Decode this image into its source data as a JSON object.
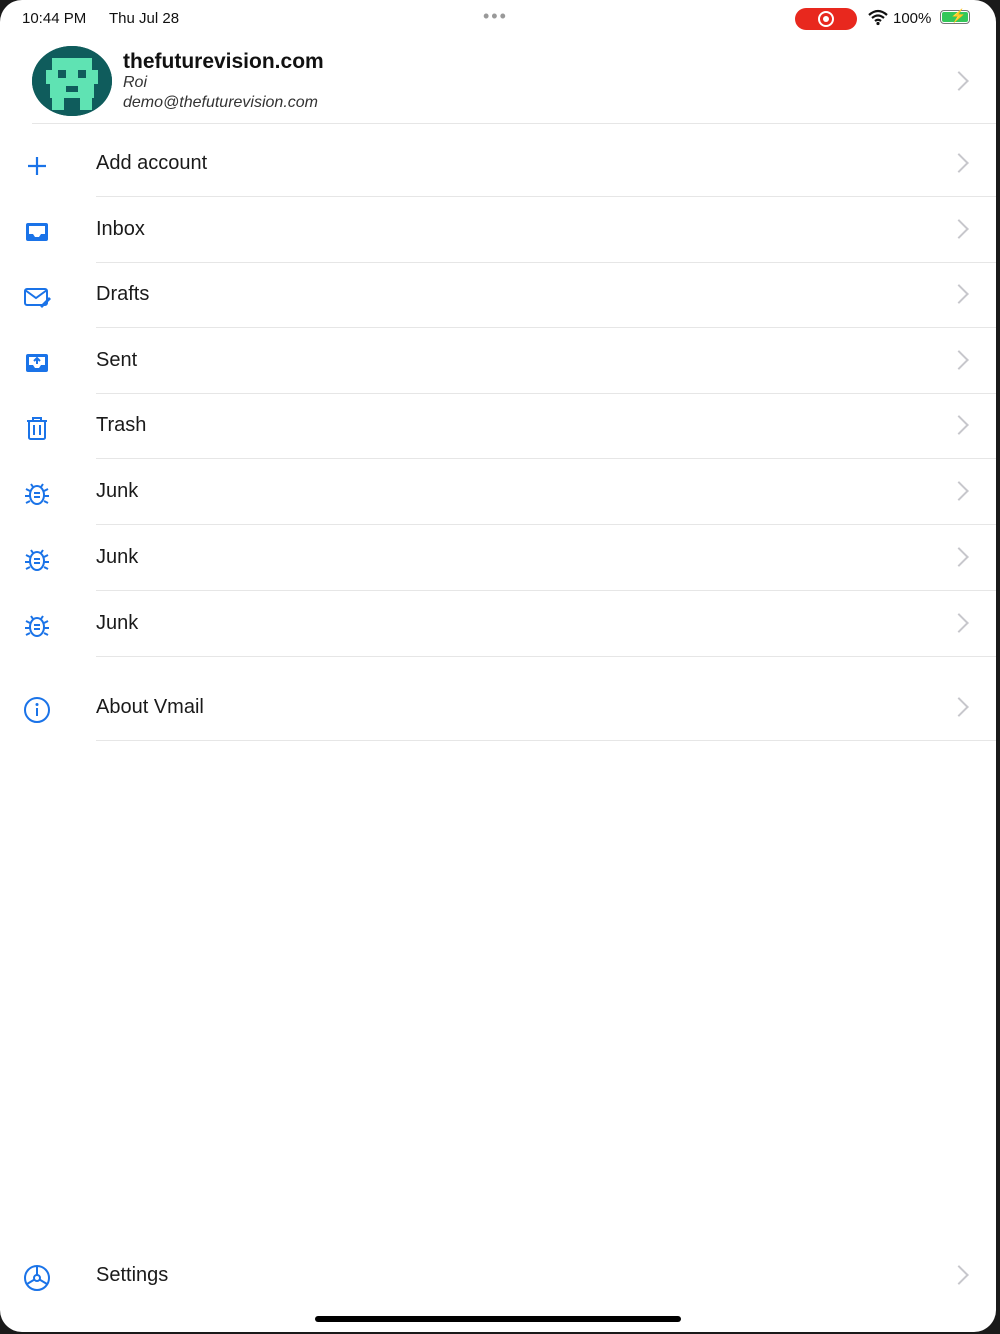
{
  "status_bar": {
    "time": "10:44 PM",
    "date": "Thu Jul 28",
    "battery": "100%"
  },
  "account": {
    "name": "thefuturevision.com",
    "user": "Roi",
    "email": "demo@thefuturevision.com"
  },
  "menu": {
    "add_account": "Add account",
    "inbox": "Inbox",
    "drafts": "Drafts",
    "sent": "Sent",
    "trash": "Trash",
    "junk1": "Junk",
    "junk2": "Junk",
    "junk3": "Junk",
    "about": "About Vmail",
    "settings": "Settings"
  },
  "colors": {
    "accent": "#1a73e8",
    "recording": "#e8281e",
    "battery": "#34c759"
  }
}
